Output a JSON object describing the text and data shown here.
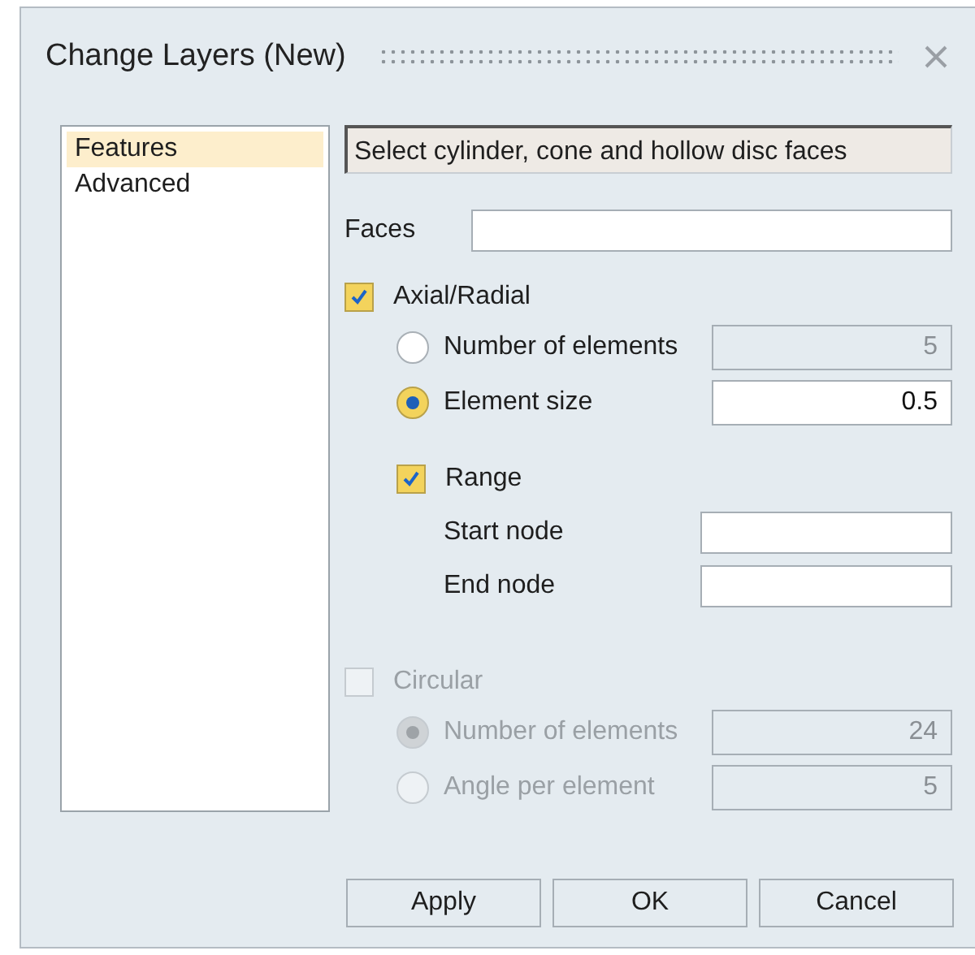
{
  "window": {
    "title": "Change Layers (New)"
  },
  "sidebar": {
    "items": [
      {
        "label": "Features",
        "selected": true
      },
      {
        "label": "Advanced",
        "selected": false
      }
    ]
  },
  "prompt": "Select cylinder, cone and hollow disc faces",
  "faces": {
    "label": "Faces"
  },
  "axial": {
    "label": "Axial/Radial",
    "checked": true,
    "disabled": false,
    "options": [
      {
        "label": "Number of elements",
        "selected": false,
        "value": "5"
      },
      {
        "label": "Element size",
        "selected": true,
        "value": "0.5"
      }
    ],
    "range": {
      "label": "Range",
      "checked": true,
      "fields": [
        {
          "label": "Start node"
        },
        {
          "label": "End node"
        }
      ]
    }
  },
  "circular": {
    "label": "Circular",
    "checked": false,
    "disabled": true,
    "options": [
      {
        "label": "Number of elements",
        "selected": true,
        "value": "24"
      },
      {
        "label": "Angle per element",
        "selected": false,
        "value": "5"
      }
    ]
  },
  "buttons": [
    "Apply",
    "OK",
    "Cancel"
  ]
}
